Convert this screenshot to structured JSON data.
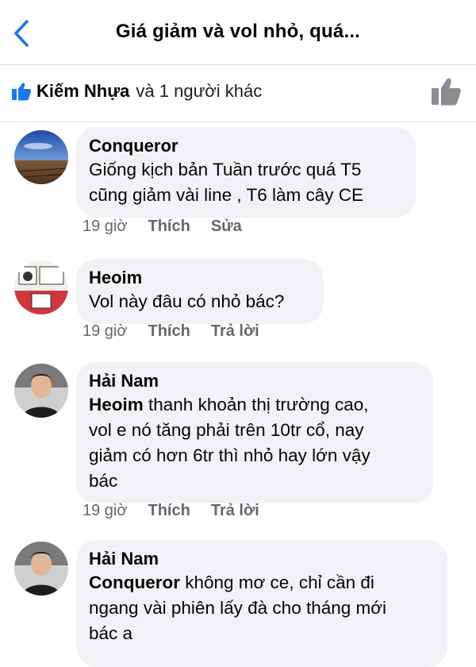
{
  "header": {
    "title": "Giá giảm và vol nhỏ, quá..."
  },
  "likes": {
    "name": "Kiếm Nhựa",
    "rest": "và 1 người khác"
  },
  "comments": [
    {
      "author": "Conqueror",
      "mention": "",
      "text": "Giống kịch bản Tuần trước quá T5\ncũng giảm vài line , T6 làm cây CE",
      "time": "19 giờ",
      "like_label": "Thích",
      "action_label": "Sửa"
    },
    {
      "author": "Heoim",
      "mention": "",
      "text": "Vol này đâu có nhỏ bác?",
      "time": "19 giờ",
      "like_label": "Thích",
      "action_label": "Trả lời"
    },
    {
      "author": "Hải Nam",
      "mention": "Heoim",
      "text": "  thanh khoản thị trường cao,\nvol e nó tăng phải trên 10tr cổ, nay\ngiảm có hơn 6tr thì nhỏ hay lớn vậy\nbác",
      "time": "19 giờ",
      "like_label": "Thích",
      "action_label": "Trả lời"
    },
    {
      "author": "Hải Nam",
      "mention": "Conqueror",
      "text": "  không mơ ce, chỉ cần đi\nngang vài phiên lấy đà cho tháng mới\nbác a",
      "time": "",
      "like_label": "",
      "action_label": ""
    }
  ],
  "colors": {
    "accent": "#1877f2",
    "bubble": "#f0f2f5",
    "meta": "#65676b"
  },
  "icons": {
    "back": "chevron-left-icon",
    "like_small": "thumbs-up-icon",
    "like_large": "thumbs-up-outline-icon"
  }
}
